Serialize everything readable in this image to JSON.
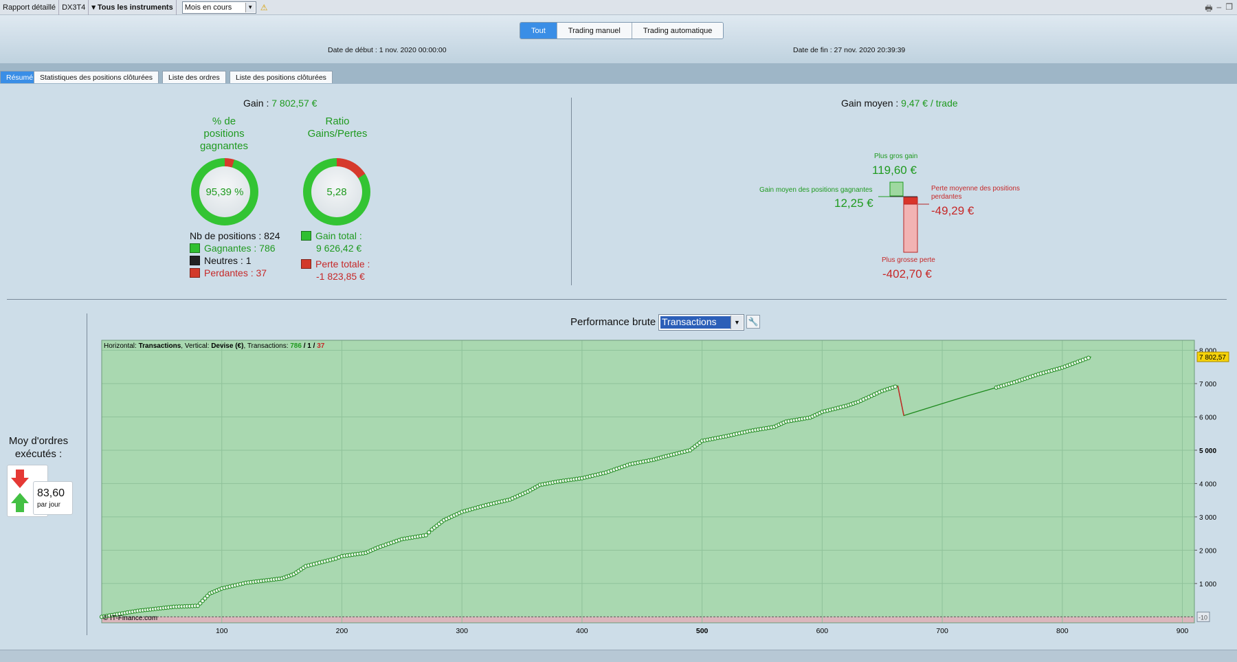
{
  "toolbar": {
    "report": "Rapport détaillé",
    "account": "DX3T4",
    "instruments": "▾ Tous les instruments",
    "period": "Mois en cours"
  },
  "header": {
    "filters": [
      "Tout",
      "Trading manuel",
      "Trading automatique"
    ],
    "start_date": "Date de début :  1 nov. 2020 00:00:00",
    "end_date": "Date de fin :  27 nov. 2020 20:39:39"
  },
  "tabs": [
    "Résumé",
    "Statistiques des positions clôturées",
    "Liste des ordres",
    "Liste des positions clôturées"
  ],
  "summary": {
    "gain_label": "Gain :",
    "gain_value": "7 802,57 €",
    "winrate_title": [
      "% de",
      "positions",
      "gagnantes"
    ],
    "winrate_value": "95,39 %",
    "winrate_fraction": 0.9539,
    "ratio_title": [
      "Ratio",
      "Gains/Pertes"
    ],
    "ratio_value": "5,28",
    "ratio_fraction": 0.84,
    "nb_positions": "Nb de positions : 824",
    "gagnantes": "Gagnantes : 786",
    "neutres": "Neutres : 1",
    "perdantes": "Perdantes : 37",
    "gain_total_label": "Gain total :",
    "gain_total_value": "9 626,42 €",
    "perte_totale_label": "Perte totale :",
    "perte_totale_value": "-1 823,85 €",
    "avg_gain_label": "Gain moyen :",
    "avg_gain_value": "9,47 € / trade",
    "biggest_gain_label": "Plus gros gain",
    "biggest_gain_value": "119,60 €",
    "avg_win_label": "Gain moyen des positions gagnantes",
    "avg_win_value": "12,25 €",
    "avg_loss_label_1": "Perte moyenne des positions",
    "avg_loss_label_2": "perdantes",
    "avg_loss_value": "-49,29 €",
    "biggest_loss_label": "Plus grosse perte",
    "biggest_loss_value": "-402,70 €"
  },
  "orders": {
    "title_1": "Moy d'ordres",
    "title_2": "exécutés :",
    "value": "83,60",
    "unit": "par jour"
  },
  "performance": {
    "title": "Performance brute",
    "mode": "Transactions",
    "header_prefix": "Horizontal: ",
    "header_h": "Transactions",
    "header_mid": ", Vertical: ",
    "header_v": "Devise (€)",
    "header_tx": ", Transactions: ",
    "header_win": "786",
    "header_sep": " / ",
    "header_neutral": "1",
    "header_loss": "37",
    "last_value_label": "7 802,57",
    "zero_label": "-10",
    "copyright": "© IT-Finance.com"
  },
  "chart_data": {
    "type": "line",
    "xlabel": "",
    "ylabel": "",
    "xlim": [
      0,
      910
    ],
    "ylim": [
      -180,
      8300
    ],
    "x_ticks": [
      100,
      200,
      300,
      400,
      500,
      600,
      700,
      800,
      900
    ],
    "y_ticks": [
      1000,
      2000,
      3000,
      4000,
      5000,
      6000,
      7000,
      8000
    ],
    "x_tick_labels": [
      "100",
      "200",
      "300",
      "400",
      "500",
      "600",
      "700",
      "800",
      "900"
    ],
    "y_tick_labels": [
      "1 000",
      "2 000",
      "3 000",
      "4 000",
      "5 000",
      "6 000",
      "7 000",
      "8 000"
    ],
    "series": [
      {
        "values": [
          [
            0,
            0
          ],
          [
            30,
            180
          ],
          [
            60,
            300
          ],
          [
            80,
            330
          ],
          [
            90,
            700
          ],
          [
            100,
            850
          ],
          [
            120,
            1020
          ],
          [
            150,
            1150
          ],
          [
            160,
            1280
          ],
          [
            170,
            1520
          ],
          [
            195,
            1750
          ],
          [
            200,
            1820
          ],
          [
            220,
            1920
          ],
          [
            230,
            2080
          ],
          [
            250,
            2330
          ],
          [
            270,
            2450
          ],
          [
            275,
            2620
          ],
          [
            285,
            2900
          ],
          [
            300,
            3150
          ],
          [
            320,
            3350
          ],
          [
            340,
            3520
          ],
          [
            355,
            3760
          ],
          [
            365,
            3960
          ],
          [
            380,
            4060
          ],
          [
            400,
            4160
          ],
          [
            420,
            4330
          ],
          [
            440,
            4580
          ],
          [
            460,
            4720
          ],
          [
            470,
            4820
          ],
          [
            490,
            5000
          ],
          [
            500,
            5280
          ],
          [
            520,
            5420
          ],
          [
            540,
            5580
          ],
          [
            560,
            5700
          ],
          [
            570,
            5860
          ],
          [
            590,
            5980
          ],
          [
            600,
            6150
          ],
          [
            620,
            6330
          ],
          [
            630,
            6450
          ],
          [
            650,
            6780
          ],
          [
            663,
            6930
          ],
          [
            668,
            6040
          ],
          [
            700,
            6400
          ],
          [
            720,
            6620
          ],
          [
            745,
            6880
          ],
          [
            760,
            7040
          ],
          [
            780,
            7280
          ],
          [
            800,
            7480
          ],
          [
            815,
            7680
          ],
          [
            824,
            7802.57
          ]
        ]
      }
    ],
    "colors": {
      "line": "#1d8a1d",
      "loss_segment": "#c62828",
      "area_positive": "#a9d8b0",
      "area_negative": "#dbb6bc"
    },
    "grid": true,
    "last_value": 7802.57
  }
}
